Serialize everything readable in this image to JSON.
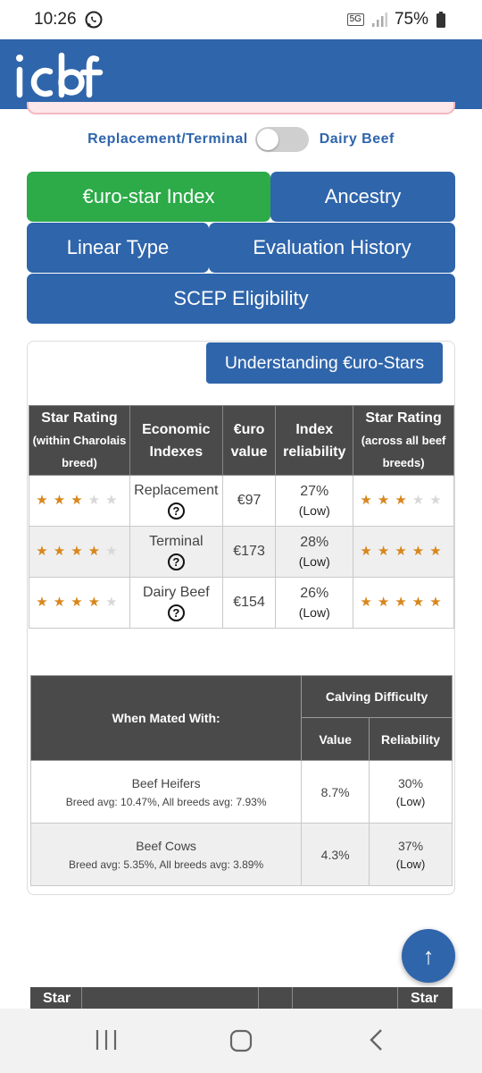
{
  "status_bar": {
    "time": "10:26",
    "network": "5G",
    "battery": "75%"
  },
  "header": {
    "logo_text": "icbf"
  },
  "toggle": {
    "left_label": "Replacement/Terminal",
    "right_label": "Dairy Beef"
  },
  "tabs": [
    {
      "label": "€uro-star Index"
    },
    {
      "label": "Ancestry"
    },
    {
      "label": "Linear Type"
    },
    {
      "label": "Evaluation History"
    },
    {
      "label": "SCEP Eligibility"
    }
  ],
  "understanding_button": "Understanding €uro-Stars",
  "star_table": {
    "headers": {
      "star_within_1": "Star Rating",
      "star_within_2": "(within Charolais",
      "star_within_3": "breed)",
      "economic_1": "Economic",
      "economic_2": "Indexes",
      "euro_1": "€uro",
      "euro_2": "value",
      "reliability_1": "Index",
      "reliability_2": "reliability",
      "star_across_1": "Star Rating",
      "star_across_2": "(across all beef",
      "star_across_3": "breeds)"
    },
    "rows": [
      {
        "index": "Replacement",
        "value": "€97",
        "reliability": "27%",
        "reliability_label": "(Low)",
        "stars_within": 3,
        "stars_across": 3
      },
      {
        "index": "Terminal",
        "value": "€173",
        "reliability": "28%",
        "reliability_label": "(Low)",
        "stars_within": 4,
        "stars_across": 5
      },
      {
        "index": "Dairy Beef",
        "value": "€154",
        "reliability": "26%",
        "reliability_label": "(Low)",
        "stars_within": 4,
        "stars_across": 5
      }
    ],
    "help_symbol": "?"
  },
  "calving_table": {
    "mated_header": "When Mated With:",
    "group_header": "Calving Difficulty",
    "value_header": "Value",
    "reliability_header": "Reliability",
    "rows": [
      {
        "name": "Beef Heifers",
        "avg": "Breed avg: 10.47%, All breeds avg: 7.93%",
        "value": "8.7%",
        "reliability": "30%",
        "reliability_label": "(Low)"
      },
      {
        "name": "Beef Cows",
        "avg": "Breed avg: 5.35%, All breeds avg: 3.89%",
        "value": "4.3%",
        "reliability": "37%",
        "reliability_label": "(Low)"
      }
    ]
  },
  "next_table": {
    "first_header": "Star",
    "last_header": "Star"
  },
  "fab_icon": "↑",
  "colors": {
    "primary": "#2f65ab",
    "active_tab": "#2cab48",
    "star": "#d8861c",
    "table_header": "#4a4a4a"
  }
}
